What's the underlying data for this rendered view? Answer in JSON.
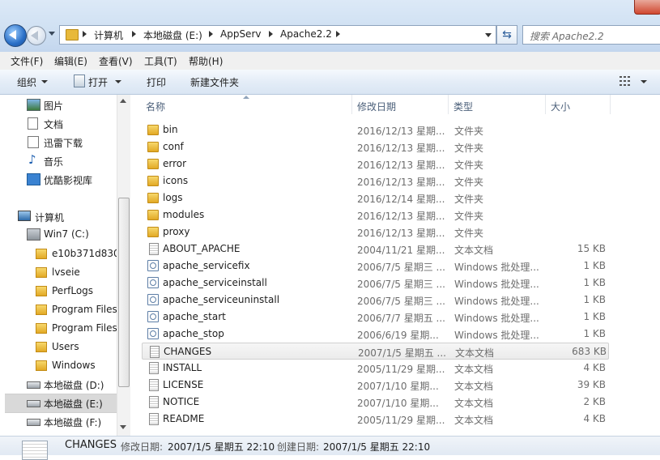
{
  "address": {
    "crumbs": [
      "计算机",
      "本地磁盘 (E:)",
      "AppServ",
      "Apache2.2"
    ],
    "search_placeholder": "搜索 Apache2.2"
  },
  "menu": [
    "文件(F)",
    "编辑(E)",
    "查看(V)",
    "工具(T)",
    "帮助(H)"
  ],
  "toolbar": {
    "organize": "组织",
    "open": "打开",
    "print": "打印",
    "new_folder": "新建文件夹"
  },
  "nav": {
    "libraries": [
      {
        "label": "图片",
        "icon": "pictures-icon"
      },
      {
        "label": "文档",
        "icon": "documents-icon"
      },
      {
        "label": "迅雷下载",
        "icon": "download-icon"
      },
      {
        "label": "音乐",
        "icon": "music-icon"
      },
      {
        "label": "优酷影视库",
        "icon": "video-icon"
      }
    ],
    "computer": "计算机",
    "drive_c": "Win7 (C:)",
    "c_children": [
      "e10b371d830",
      "lvseie",
      "PerfLogs",
      "Program Files",
      "Program Files",
      "Users",
      "Windows"
    ],
    "drives": [
      "本地磁盘 (D:)",
      "本地磁盘 (E:)",
      "本地磁盘 (F:)"
    ]
  },
  "columns": {
    "name": "名称",
    "date": "修改日期",
    "type": "类型",
    "size": "大小"
  },
  "files": [
    {
      "name": "bin",
      "date": "2016/12/13 星期...",
      "type": "文件夹",
      "size": "",
      "icon": "folder-icon"
    },
    {
      "name": "conf",
      "date": "2016/12/13 星期...",
      "type": "文件夹",
      "size": "",
      "icon": "folder-icon"
    },
    {
      "name": "error",
      "date": "2016/12/13 星期...",
      "type": "文件夹",
      "size": "",
      "icon": "folder-icon"
    },
    {
      "name": "icons",
      "date": "2016/12/13 星期...",
      "type": "文件夹",
      "size": "",
      "icon": "folder-icon"
    },
    {
      "name": "logs",
      "date": "2016/12/14 星期...",
      "type": "文件夹",
      "size": "",
      "icon": "folder-icon"
    },
    {
      "name": "modules",
      "date": "2016/12/13 星期...",
      "type": "文件夹",
      "size": "",
      "icon": "folder-icon"
    },
    {
      "name": "proxy",
      "date": "2016/12/13 星期...",
      "type": "文件夹",
      "size": "",
      "icon": "folder-icon"
    },
    {
      "name": "ABOUT_APACHE",
      "date": "2004/11/21 星期...",
      "type": "文本文档",
      "size": "15 KB",
      "icon": "text-file-icon"
    },
    {
      "name": "apache_servicefix",
      "date": "2006/7/5 星期三 ...",
      "type": "Windows 批处理...",
      "size": "1 KB",
      "icon": "batch-file-icon"
    },
    {
      "name": "apache_serviceinstall",
      "date": "2006/7/5 星期三 ...",
      "type": "Windows 批处理...",
      "size": "1 KB",
      "icon": "batch-file-icon"
    },
    {
      "name": "apache_serviceuninstall",
      "date": "2006/7/5 星期三 ...",
      "type": "Windows 批处理...",
      "size": "1 KB",
      "icon": "batch-file-icon"
    },
    {
      "name": "apache_start",
      "date": "2006/7/7 星期五 ...",
      "type": "Windows 批处理...",
      "size": "1 KB",
      "icon": "batch-file-icon"
    },
    {
      "name": "apache_stop",
      "date": "2006/6/19 星期...",
      "type": "Windows 批处理...",
      "size": "1 KB",
      "icon": "batch-file-icon"
    },
    {
      "name": "CHANGES",
      "date": "2007/1/5 星期五 ...",
      "type": "文本文档",
      "size": "683 KB",
      "icon": "text-file-icon",
      "selected": true
    },
    {
      "name": "INSTALL",
      "date": "2005/11/29 星期...",
      "type": "文本文档",
      "size": "4 KB",
      "icon": "text-file-icon"
    },
    {
      "name": "LICENSE",
      "date": "2007/1/10 星期...",
      "type": "文本文档",
      "size": "39 KB",
      "icon": "text-file-icon"
    },
    {
      "name": "NOTICE",
      "date": "2007/1/10 星期...",
      "type": "文本文档",
      "size": "2 KB",
      "icon": "text-file-icon"
    },
    {
      "name": "README",
      "date": "2005/11/29 星期...",
      "type": "文本文档",
      "size": "4 KB",
      "icon": "text-file-icon"
    }
  ],
  "details": {
    "name": "CHANGES",
    "modified_label": "修改日期:",
    "modified": "2007/1/5 星期五 22:10",
    "created_label": "创建日期:",
    "created": "2007/1/5 星期五 22:10"
  }
}
